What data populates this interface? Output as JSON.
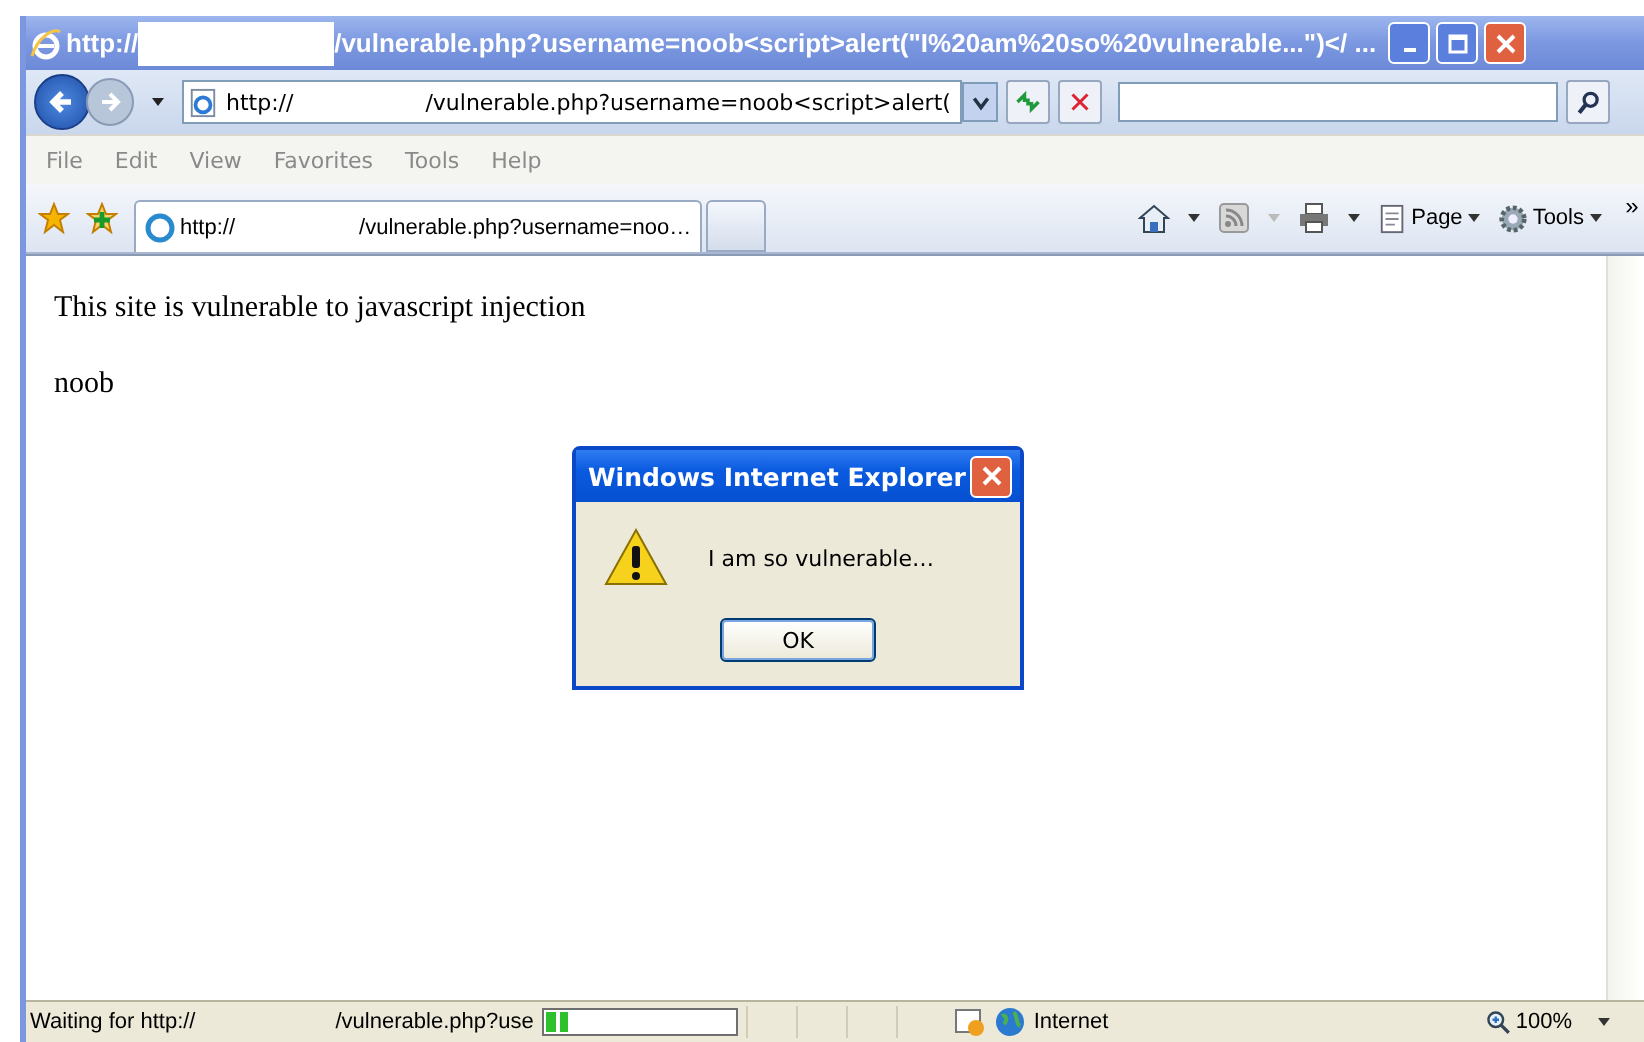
{
  "window": {
    "title_prefix": "http://",
    "title_rest": "/vulnerable.php?username=noob<script>alert(\"I%20am%20so%20vulnerable...\")</ ..."
  },
  "address_bar": {
    "url_prefix": "http://",
    "url_rest": "/vulnerable.php?username=noob<script>alert("
  },
  "menu": [
    "File",
    "Edit",
    "View",
    "Favorites",
    "Tools",
    "Help"
  ],
  "tabs": [
    {
      "label_prefix": "http://",
      "label_rest": "/vulnerable.php?username=noo…",
      "selected": true
    }
  ],
  "command_bar": {
    "page": "Page",
    "tools": "Tools",
    "more": "»"
  },
  "page": {
    "paragraphs": [
      "This site is vulnerable to javascript injection",
      "noob"
    ]
  },
  "dialog": {
    "title": "Windows Internet Explorer",
    "message": "I am so vulnerable…",
    "button": "OK"
  },
  "status_bar": {
    "status_prefix": "Waiting for http://",
    "status_rest": "/vulnerable.php?use",
    "progress": {
      "level": 0.12
    },
    "zone": "Internet",
    "zoom": "100%"
  }
}
